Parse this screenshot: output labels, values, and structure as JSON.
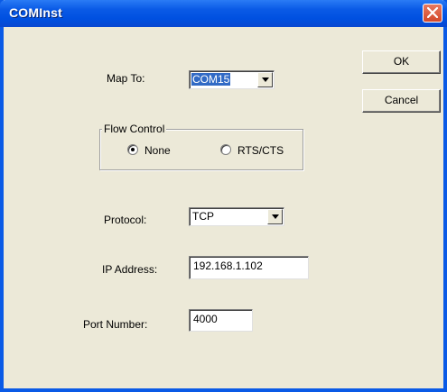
{
  "window": {
    "title": "COMInst"
  },
  "map_to": {
    "label": "Map To:",
    "value": "COM15"
  },
  "buttons": {
    "ok": "OK",
    "cancel": "Cancel"
  },
  "flow_control": {
    "title": "Flow Control",
    "options": [
      {
        "label": "None",
        "selected": true
      },
      {
        "label": "RTS/CTS",
        "selected": false
      }
    ]
  },
  "protocol": {
    "label": "Protocol:",
    "value": "TCP"
  },
  "ip_address": {
    "label": "IP Address:",
    "value": "192.168.1.102"
  },
  "port_number": {
    "label": "Port Number:",
    "value": "4000"
  },
  "colors": {
    "titlebar": "#0a5ae6",
    "dialog_bg": "#ece9d8",
    "close_button": "#d2472a",
    "selection": "#316ac5"
  },
  "icons": {
    "close": "close-x-icon",
    "dropdown": "chevron-down-icon"
  }
}
